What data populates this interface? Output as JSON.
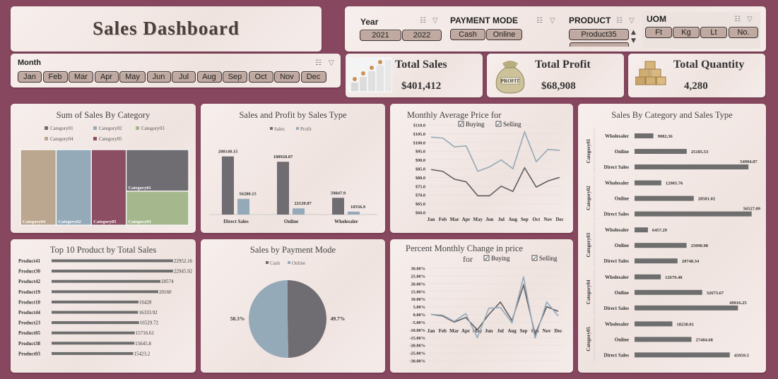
{
  "title": "Sales Dashboard",
  "slicers": {
    "year": {
      "title": "Year",
      "items": [
        "2021",
        "2022"
      ]
    },
    "payment": {
      "title": "PAYMENT MODE",
      "items": [
        "Cash",
        "Online"
      ]
    },
    "product": {
      "title": "PRODUCT",
      "items": [
        "Product35"
      ]
    },
    "uom": {
      "title": "UOM",
      "items": [
        "Ft",
        "Kg",
        "Lt",
        "No."
      ]
    },
    "month": {
      "title": "Month",
      "items": [
        "Jan",
        "Feb",
        "Mar",
        "Apr",
        "May",
        "Jun",
        "Jul",
        "Aug",
        "Sep",
        "Oct",
        "Nov",
        "Dec"
      ]
    },
    "icons": {
      "multiselect": "☷",
      "clear": "▽"
    }
  },
  "kpis": {
    "sales": {
      "title": "Total Sales",
      "value": "$401,412",
      "icon": "sales-stairs-icon"
    },
    "profit": {
      "title": "Total Profit",
      "value": "$68,908",
      "icon": "profit-bag-icon"
    },
    "quantity": {
      "title": "Total Quantity",
      "value": "4,280",
      "icon": "boxes-icon"
    }
  },
  "colors": {
    "bg": "#87475f",
    "gray": "#6f6c72",
    "blue": "#94aab9",
    "tan": "#bba68f",
    "plum": "#8b4e63",
    "green": "#a5b88d",
    "dark": "#6e6e6e"
  },
  "chart_data": [
    {
      "id": "treemap",
      "type": "treemap",
      "title": "Sum of Sales By Category",
      "legend": [
        "Category01",
        "Category02",
        "Category03",
        "Category04",
        "Category05"
      ],
      "items": [
        {
          "name": "Category04",
          "value": 85000
        },
        {
          "name": "Category02",
          "value": 84000
        },
        {
          "name": "Category05",
          "value": 83000
        },
        {
          "name": "Category01",
          "value": 82000
        },
        {
          "name": "Category03",
          "value": 67000
        }
      ]
    },
    {
      "id": "salestype",
      "type": "bar",
      "title": "Sales and Profit by Sales Type",
      "categories": [
        "Direct Sales",
        "Online",
        "Wholesaler"
      ],
      "series": [
        {
          "name": "Sales",
          "values": [
            208140.15,
            188928.87,
            59847.9
          ],
          "labels": [
            "208140.15",
            "188928.87",
            "59847.9"
          ]
        },
        {
          "name": "Profit",
          "values": [
            56280.15,
            22120.87,
            10556.9
          ],
          "labels": [
            "56280.15",
            "22120.87",
            "10556.9"
          ]
        }
      ],
      "ylim": [
        0,
        240000
      ]
    },
    {
      "id": "avgprice",
      "type": "line",
      "title": "Monthly Average Price for",
      "checks": [
        "Buying",
        "Selling"
      ],
      "categories": [
        "Jan",
        "Feb",
        "Mar",
        "Apr",
        "May",
        "Jun",
        "Jul",
        "Aug",
        "Sep",
        "Oct",
        "Nov",
        "Dec"
      ],
      "yticks": [
        "$110.0",
        "$105.0",
        "$100.0",
        "$95.0",
        "$90.0",
        "$85.0",
        "$80.0",
        "$75.0",
        "$70.0",
        "$65.0",
        "$60.0"
      ],
      "ylim": [
        60,
        110
      ],
      "series": [
        {
          "name": "Selling",
          "values": [
            103,
            102.5,
            97.5,
            98,
            83.5,
            86,
            90,
            85,
            106,
            89,
            96,
            95.5
          ]
        },
        {
          "name": "Buying",
          "values": [
            84.5,
            83.5,
            79,
            77.5,
            69.5,
            69.5,
            75,
            72,
            85.5,
            74.5,
            78,
            80
          ]
        }
      ]
    },
    {
      "id": "catsaletype",
      "type": "bar",
      "title": "Sales By Category and Sales Type",
      "groups": [
        {
          "name": "Category01",
          "rows": [
            {
              "label": "Wholesaler",
              "value": 9082.36,
              "text": "9082.36"
            },
            {
              "label": "Online",
              "value": 25185.53,
              "text": "25185.53"
            },
            {
              "label": "Direct Sales",
              "value": 54994.07,
              "text": "54994.07"
            }
          ]
        },
        {
          "name": "Category02",
          "rows": [
            {
              "label": "Wholesaler",
              "value": 12905.76,
              "text": "12905.76"
            },
            {
              "label": "Online",
              "value": 28581.02,
              "text": "28581.02"
            },
            {
              "label": "Direct Sales",
              "value": 56527.09,
              "text": "56527.09"
            }
          ]
        },
        {
          "name": "Category03",
          "rows": [
            {
              "label": "Wholesaler",
              "value": 6457.29,
              "text": "6457.29"
            },
            {
              "label": "Online",
              "value": 25098.98,
              "text": "25098.98"
            },
            {
              "label": "Direct Sales",
              "value": 20748.34,
              "text": "20748.34"
            }
          ]
        },
        {
          "name": "Category04",
          "rows": [
            {
              "label": "Wholesaler",
              "value": 12679.48,
              "text": "12679.48"
            },
            {
              "label": "Online",
              "value": 32673.67,
              "text": "32673.67"
            },
            {
              "label": "Direct Sales",
              "value": 49916.25,
              "text": "49916.25"
            }
          ]
        },
        {
          "name": "Category05",
          "rows": [
            {
              "label": "Wholesaler",
              "value": 18238.01,
              "text": "18238.01"
            },
            {
              "label": "Online",
              "value": 27484.68,
              "text": "27484.68"
            },
            {
              "label": "Direct Sales",
              "value": 45959.5,
              "text": "45959.5"
            }
          ]
        }
      ],
      "xlim": [
        0,
        58000
      ]
    },
    {
      "id": "top10",
      "type": "bar",
      "title": "Top 10 Product by Total Sales",
      "categories": [
        "Product41",
        "Product30",
        "Product42",
        "Product19",
        "Product10",
        "Product44",
        "Product23",
        "Product05",
        "Product38",
        "Product03"
      ],
      "values": [
        22952.16,
        22945.92,
        20574,
        20160,
        16428,
        16333.92,
        16529.72,
        15716.61,
        15645.8,
        15423.2
      ],
      "labels": [
        "22952.16",
        "22945.92",
        "20574",
        "20160",
        "16428",
        "16333.92",
        "16529.72",
        "15716.61",
        "15645.8",
        "15423.2"
      ],
      "xlim": [
        0,
        23500
      ]
    },
    {
      "id": "paymode",
      "type": "pie",
      "title": "Sales by Payment Mode",
      "legend": [
        "Cash",
        "Online"
      ],
      "slices": [
        {
          "name": "Cash",
          "value": 49.7,
          "label": "49.7%"
        },
        {
          "name": "Online",
          "value": 50.3,
          "label": "50.3%"
        }
      ]
    },
    {
      "id": "pctchange",
      "type": "line",
      "title": "Percent Monthly Change in price",
      "subtitle": "for",
      "checks": [
        "Buying",
        "Selling"
      ],
      "categories": [
        "Jan",
        "Feb",
        "Mar",
        "Apr",
        "May",
        "Jun",
        "Jul",
        "Aug",
        "Sep",
        "Oct",
        "Nov",
        "Dec"
      ],
      "yticks": [
        "30.00%",
        "25.00%",
        "20.00%",
        "15.00%",
        "10.00%",
        "5.00%",
        "0.00%",
        "-5.00%",
        "-10.00%",
        "-15.00%",
        "-20.00%",
        "-25.00%",
        "-30.00%"
      ],
      "ylim": [
        -30,
        30
      ],
      "series": [
        {
          "name": "Buying",
          "values": [
            0,
            -1,
            -5,
            -2,
            -10,
            0,
            8,
            -4,
            19,
            -13,
            5,
            2
          ]
        },
        {
          "name": "Selling",
          "values": [
            0,
            -0.5,
            -4.5,
            0.5,
            -15,
            4,
            4.5,
            -5.5,
            24.5,
            -15.5,
            8,
            -1
          ]
        }
      ]
    }
  ]
}
